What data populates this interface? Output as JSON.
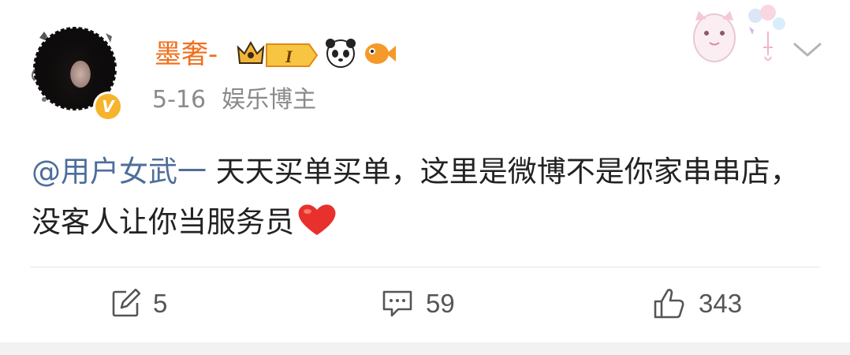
{
  "post": {
    "author": {
      "name": "墨奢-",
      "level_badge": "I"
    },
    "date": "5-16",
    "tag": "娱乐博主",
    "mention": "@用户女武一",
    "body_text": " 天天买单买单，这里是微博不是你家串串店，没客人让你当服务员"
  },
  "actions": {
    "repost_count": "5",
    "comment_count": "59",
    "like_count": "343"
  },
  "icons": {
    "repost": "repost-icon",
    "comment": "comment-icon",
    "like": "like-icon",
    "menu": "chevron-down-icon",
    "heart": "heart-emoji"
  },
  "colors": {
    "username": "#f06f1c",
    "mention": "#4e6e9b",
    "meta": "#8a8a8a",
    "verified": "#f5b42a"
  }
}
